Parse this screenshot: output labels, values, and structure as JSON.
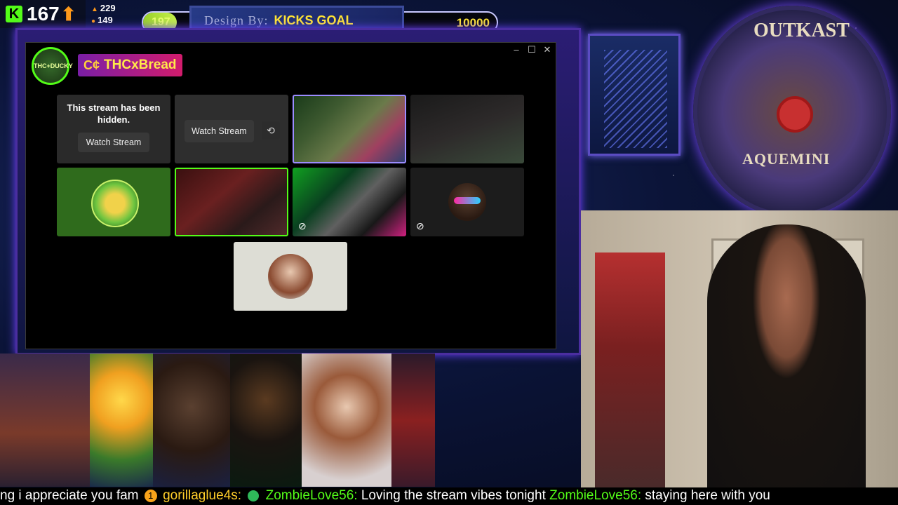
{
  "overlay": {
    "kick_count": "167",
    "mini_stats": [
      "229",
      "149"
    ]
  },
  "goal": {
    "current": "197",
    "design_text": "Design By:",
    "label": "KICKS GOAL",
    "target": "10000",
    "progress_fraction": 0.0197
  },
  "window": {
    "controls": [
      "minimize",
      "maximize",
      "close"
    ],
    "channel_logo_text": "THC+DUCKY",
    "channel_name": "THCxBread",
    "channel_badge": "C¢"
  },
  "streams": {
    "hidden_text": "This stream has been hidden.",
    "watch_label_1": "Watch Stream",
    "watch_label_2": "Watch Stream"
  },
  "record": {
    "title": "OUTKAST",
    "subtitle": "AQUEMINI"
  },
  "ticker": {
    "msg1": "ng i appreciate you fam",
    "user1": "gorillaglue4s:",
    "user2": "ZombieLove56:",
    "msg2": "Loving the stream vibes tonight",
    "user3": "ZombieLove56:",
    "msg3": "staying here with you"
  },
  "icons": {
    "kick": "kick-logo-icon",
    "up": "up-arrow-icon",
    "muted": "muted-eye-icon",
    "reset": "reset-view-icon"
  },
  "colors": {
    "kick_green": "#53fc18",
    "goal_yellow": "#ffe533",
    "accent_purple": "#6a40ff"
  }
}
